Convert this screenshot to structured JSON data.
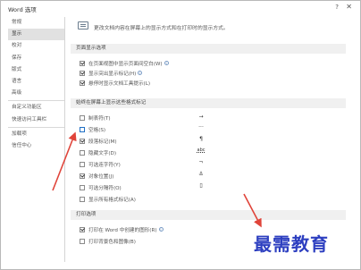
{
  "window": {
    "title": "Word 选项",
    "help": "?",
    "close": "✕"
  },
  "sidebar": {
    "items": [
      {
        "label": "常规",
        "active": false
      },
      {
        "label": "显示",
        "active": true
      },
      {
        "label": "校对",
        "active": false
      },
      {
        "label": "保存",
        "active": false
      },
      {
        "label": "版式",
        "active": false
      },
      {
        "label": "语言",
        "active": false
      },
      {
        "label": "高级",
        "active": false
      },
      {
        "label": "自定义功能区",
        "active": false
      },
      {
        "label": "快速访问工具栏",
        "active": false
      },
      {
        "label": "加载项",
        "active": false
      },
      {
        "label": "信任中心",
        "active": false
      }
    ]
  },
  "main": {
    "header_text": "更改文档内容在屏幕上的显示方式和在打印时的显示方式。",
    "page_display": {
      "title": "页面显示选项",
      "options": [
        {
          "label": "在页面视图中显示页面间空白(W)",
          "checked": true,
          "info": "i"
        },
        {
          "label": "显示突出显示标记(H)",
          "checked": true,
          "info": "i"
        },
        {
          "label": "悬停时显示文档工具提示(L)",
          "checked": true,
          "info": ""
        }
      ]
    },
    "formatting_marks": {
      "title": "始终在屏幕上显示这些格式标记",
      "options": [
        {
          "label": "制表符(T)",
          "checked": false,
          "symbol": "→"
        },
        {
          "label": "空格(S)",
          "checked": false,
          "symbol": "···"
        },
        {
          "label": "段落标记(M)",
          "checked": true,
          "symbol": "¶"
        },
        {
          "label": "隐藏文字(D)",
          "checked": false,
          "symbol": "abc"
        },
        {
          "label": "可选连字符(Y)",
          "checked": false,
          "symbol": "¬"
        },
        {
          "label": "对象位置(J)",
          "checked": true,
          "symbol": "⚓"
        },
        {
          "label": "可选分隔符(O)",
          "checked": false,
          "symbol": "▯"
        },
        {
          "label": "显示所有格式标记(A)",
          "checked": false,
          "symbol": ""
        }
      ]
    },
    "print": {
      "title": "打印选项",
      "options": [
        {
          "label": "打印在 Word 中创建的图形(R)",
          "checked": true,
          "info": "i"
        },
        {
          "label": "打印背景色和图像(B)",
          "checked": false,
          "info": ""
        }
      ]
    }
  },
  "watermark": {
    "text": "最需教育"
  },
  "colors": {
    "arrow": "#e0443a",
    "watermark": "#2d3fc0",
    "sidebar_active": "#e1e1e1"
  }
}
